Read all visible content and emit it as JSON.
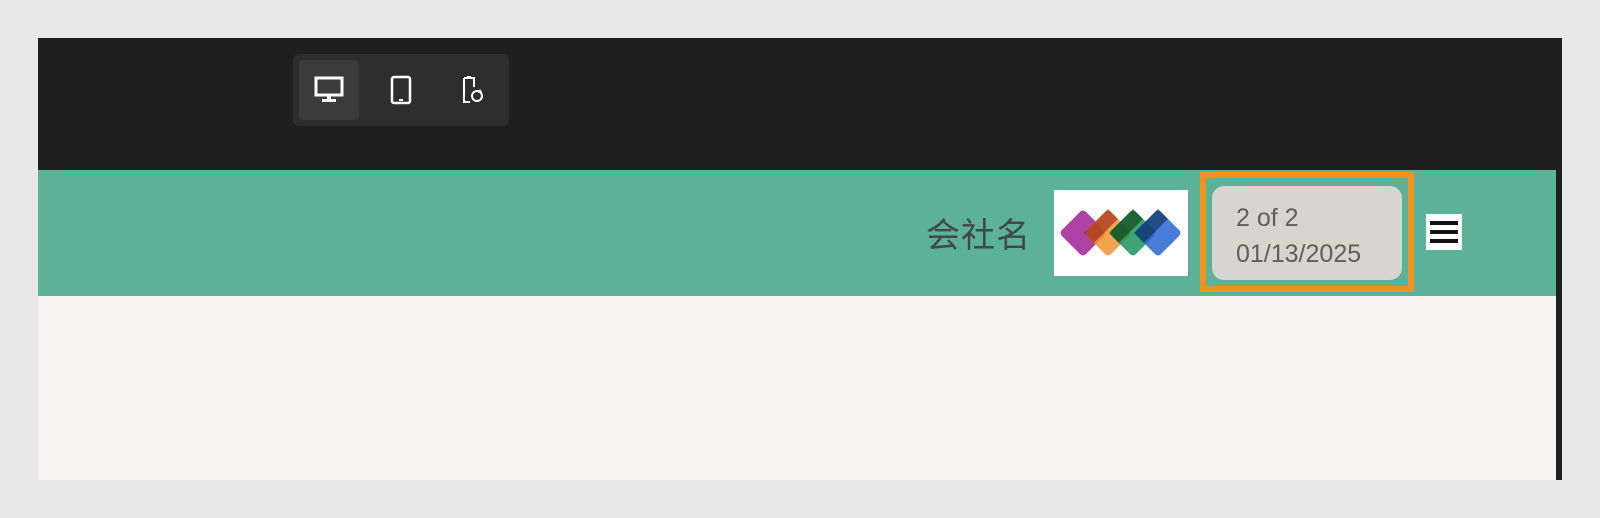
{
  "toolbar": {
    "buttons": [
      {
        "name": "desktop",
        "icon": "desktop-monitor-icon",
        "active": true
      },
      {
        "name": "tablet",
        "icon": "tablet-icon",
        "active": false
      },
      {
        "name": "rotate",
        "icon": "rotate-device-icon",
        "active": false
      }
    ]
  },
  "header": {
    "company_name": "会社名",
    "logo": {
      "icon": "four-diamonds-logo",
      "colors": [
        "#a8329e",
        "#ef8a1e",
        "#0b8a4f",
        "#1659d0"
      ]
    },
    "pagination": {
      "page_label": "2 of 2",
      "date": "01/13/2025"
    },
    "highlight_color": "#f0921e",
    "menu_icon": "hamburger-menu-icon"
  },
  "colors": {
    "header_bg": "#5cb199",
    "content_bg": "#f6f5f1",
    "frame_bg": "#1f1f1f"
  }
}
